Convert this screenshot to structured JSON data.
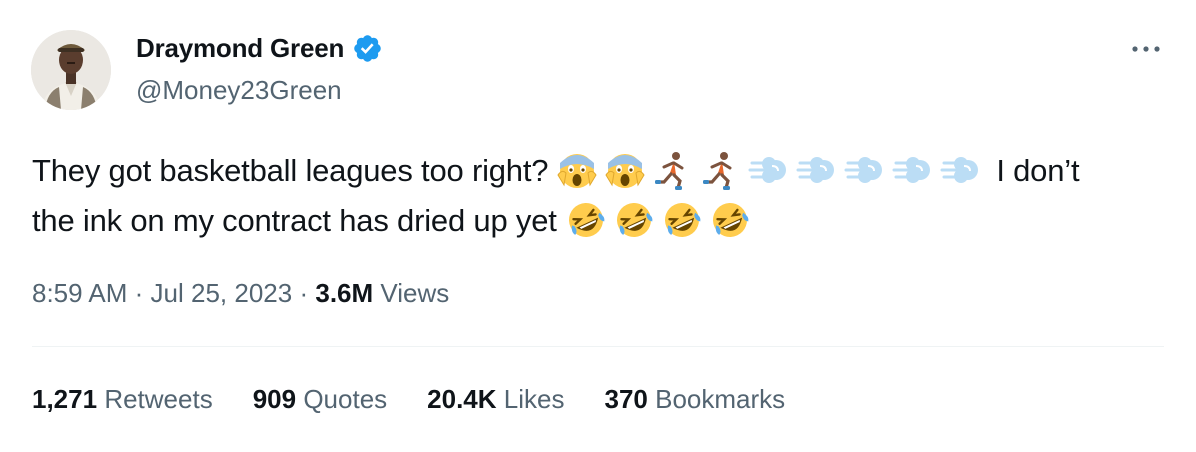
{
  "author": {
    "name": "Draymond Green",
    "handle": "@Money23Green"
  },
  "tweet": {
    "line1_text": "They got basketball leagues too right?",
    "line1_tail": "I don’t",
    "line2_text": "the ink on my contract has dried up yet",
    "emoji_line1": [
      "face-screaming-in-fear",
      "face-screaming-in-fear",
      "person-running",
      "person-running",
      "dashing-away",
      "dashing-away",
      "dashing-away",
      "dashing-away",
      "dashing-away"
    ],
    "emoji_line2": [
      "rolling-on-the-floor-laughing",
      "rolling-on-the-floor-laughing",
      "rolling-on-the-floor-laughing",
      "rolling-on-the-floor-laughing"
    ]
  },
  "meta": {
    "time": "8:59 AM",
    "sep1": "·",
    "date": "Jul 25, 2023",
    "sep2": "·",
    "views_count": "3.6M",
    "views_label": "Views"
  },
  "stats": {
    "retweets_count": "1,271",
    "retweets_label": "Retweets",
    "quotes_count": "909",
    "quotes_label": "Quotes",
    "likes_count": "20.4K",
    "likes_label": "Likes",
    "bookmarks_count": "370",
    "bookmarks_label": "Bookmarks"
  },
  "colors": {
    "verified": "#1d9bf0",
    "secondary_text": "#536471",
    "primary_text": "#0f1419"
  },
  "icons": {
    "verified": "verified-badge-icon",
    "more": "more-options-icon"
  }
}
